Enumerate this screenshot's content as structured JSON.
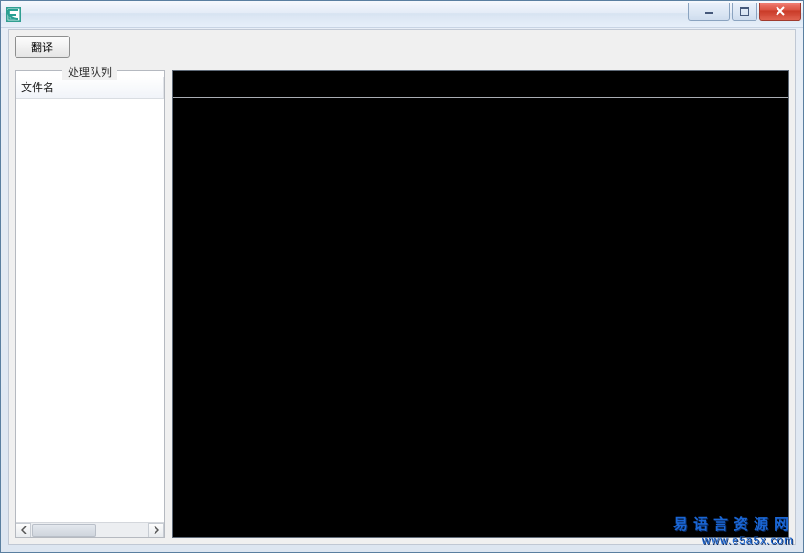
{
  "window": {
    "title": ""
  },
  "toolbar": {
    "translate_label": "翻译"
  },
  "queue": {
    "legend": "处理队列",
    "column_header": "文件名"
  },
  "watermark": {
    "line1": "易语言资源网",
    "line2": "www.e5a5x.com"
  }
}
